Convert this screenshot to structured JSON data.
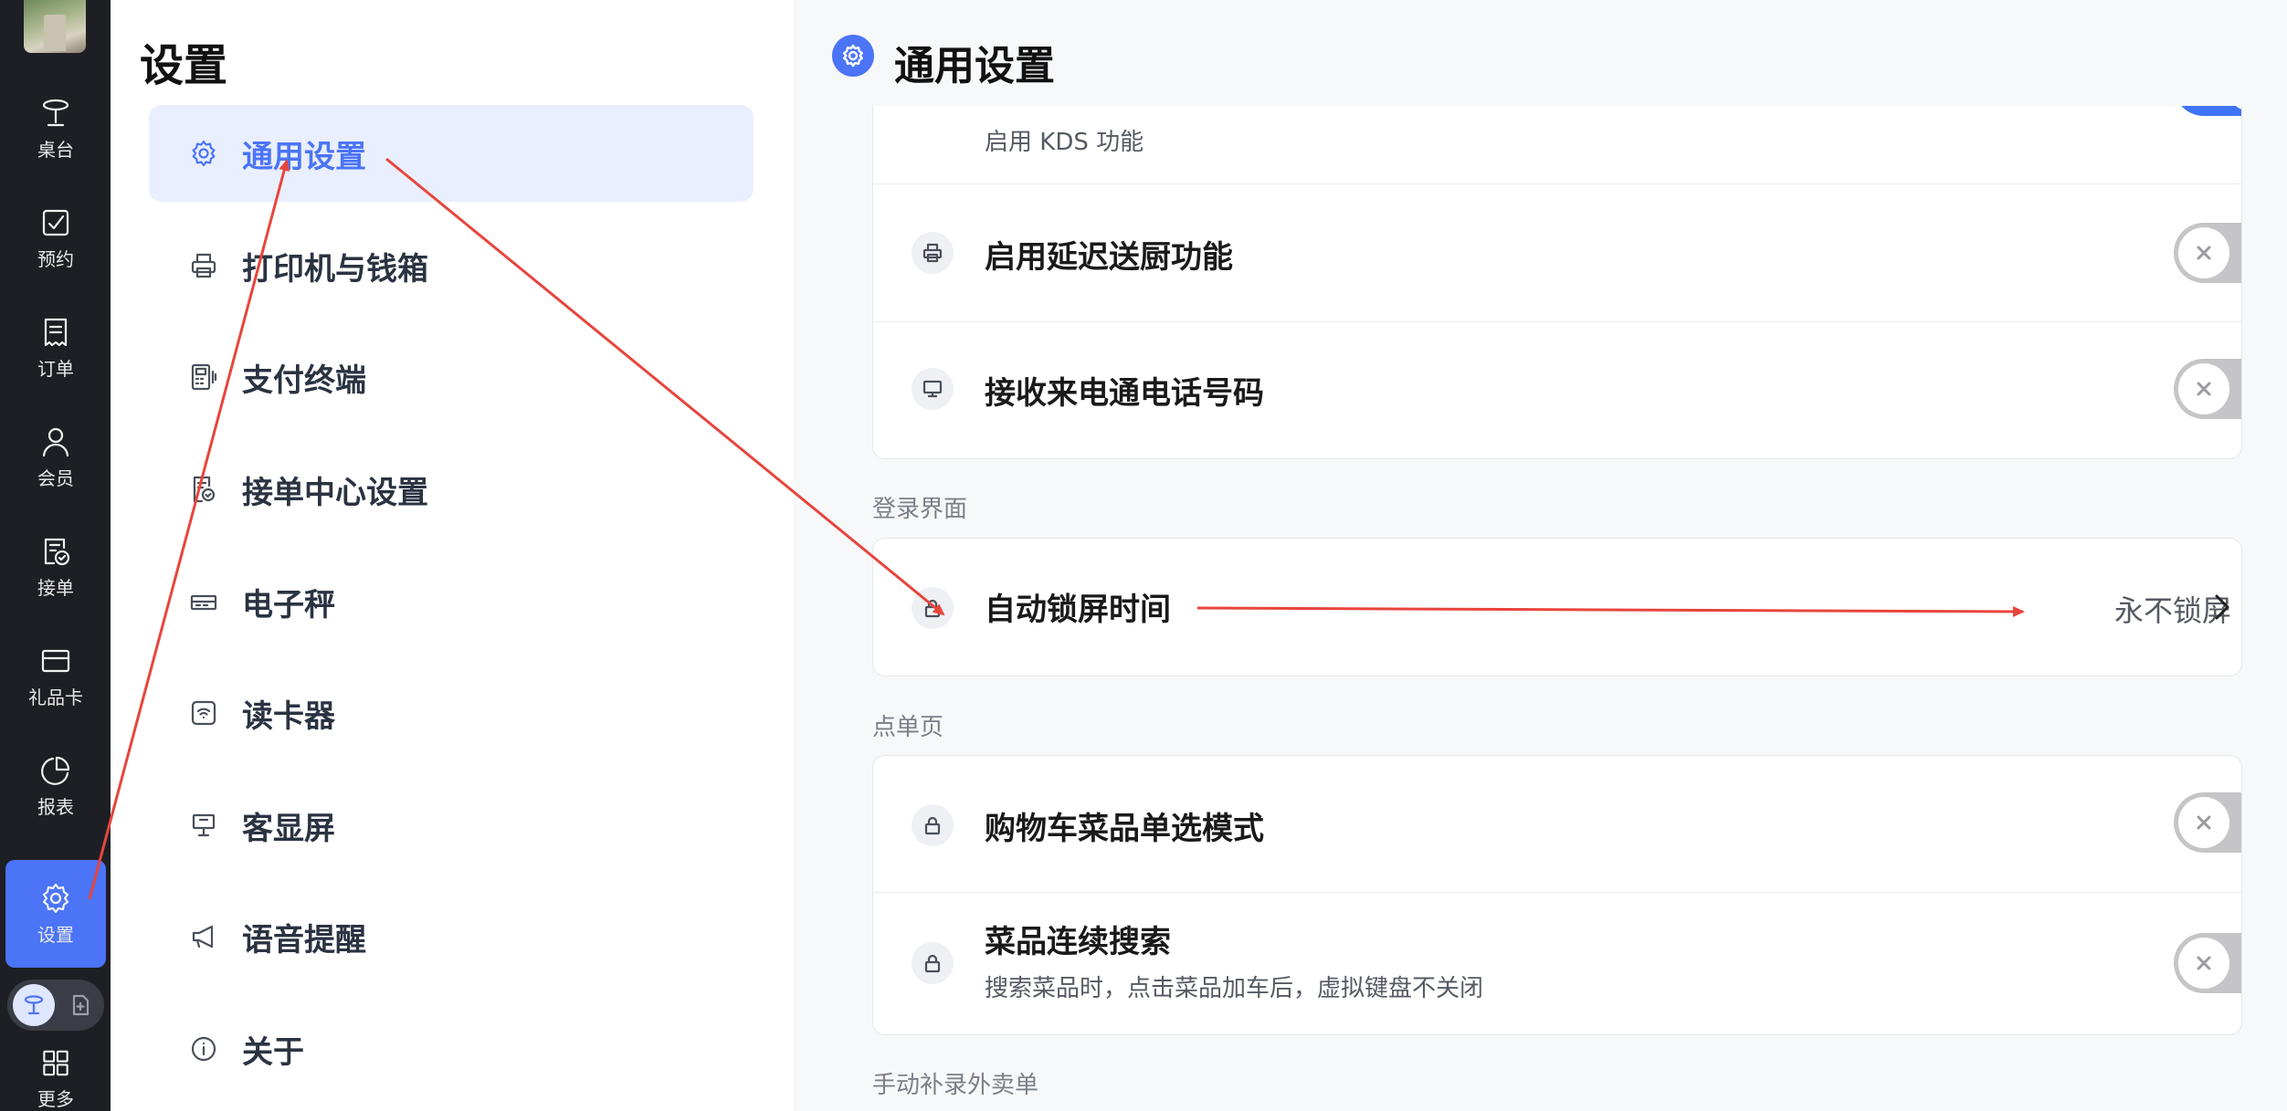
{
  "rail": {
    "items": [
      {
        "label": "桌台",
        "icon": "table-icon"
      },
      {
        "label": "预约",
        "icon": "calendar-check-icon"
      },
      {
        "label": "订单",
        "icon": "receipt-icon"
      },
      {
        "label": "会员",
        "icon": "person-icon"
      },
      {
        "label": "接单",
        "icon": "order-accept-icon"
      },
      {
        "label": "礼品卡",
        "icon": "gift-card-icon"
      },
      {
        "label": "报表",
        "icon": "pie-chart-icon"
      },
      {
        "label": "设置",
        "icon": "gear-icon",
        "active": true
      },
      {
        "label": "更多",
        "icon": "grid-icon"
      }
    ],
    "mode_switch": {
      "active_icon": "table-icon",
      "other_icon": "file-add-icon"
    }
  },
  "menu": {
    "title": "设置",
    "items": [
      {
        "label": "通用设置",
        "icon": "gear-icon",
        "active": true
      },
      {
        "label": "打印机与钱箱",
        "icon": "printer-icon"
      },
      {
        "label": "支付终端",
        "icon": "payment-terminal-icon"
      },
      {
        "label": "接单中心设置",
        "icon": "order-center-icon"
      },
      {
        "label": "电子秤",
        "icon": "scale-icon"
      },
      {
        "label": "读卡器",
        "icon": "card-reader-icon"
      },
      {
        "label": "客显屏",
        "icon": "customer-display-icon"
      },
      {
        "label": "语音提醒",
        "icon": "megaphone-icon"
      },
      {
        "label": "关于",
        "icon": "info-icon"
      }
    ]
  },
  "main": {
    "title": "通用设置",
    "top_card": {
      "rows": [
        {
          "subtitle": "启用 KDS 功能",
          "icon": "kds-icon",
          "enabled": true
        },
        {
          "title": "启用延迟送厨功能",
          "icon": "printer-icon",
          "enabled": false
        },
        {
          "title": "接收来电通电话号码",
          "icon": "monitor-icon",
          "enabled": false
        }
      ]
    },
    "login_section": {
      "label": "登录界面",
      "rows": [
        {
          "title": "自动锁屏时间",
          "icon": "lock-icon",
          "value": "永不锁屏"
        }
      ]
    },
    "order_section": {
      "label": "点单页",
      "rows": [
        {
          "title": "购物车菜品单选模式",
          "icon": "lock-icon",
          "enabled": false
        },
        {
          "title": "菜品连续搜索",
          "subtitle": "搜索菜品时，点击菜品加车后，虚拟键盘不关闭",
          "icon": "lock-icon",
          "enabled": false
        }
      ]
    },
    "manual_section": {
      "label": "手动补录外卖单"
    }
  },
  "annotation": {
    "color": "#e8453c"
  }
}
